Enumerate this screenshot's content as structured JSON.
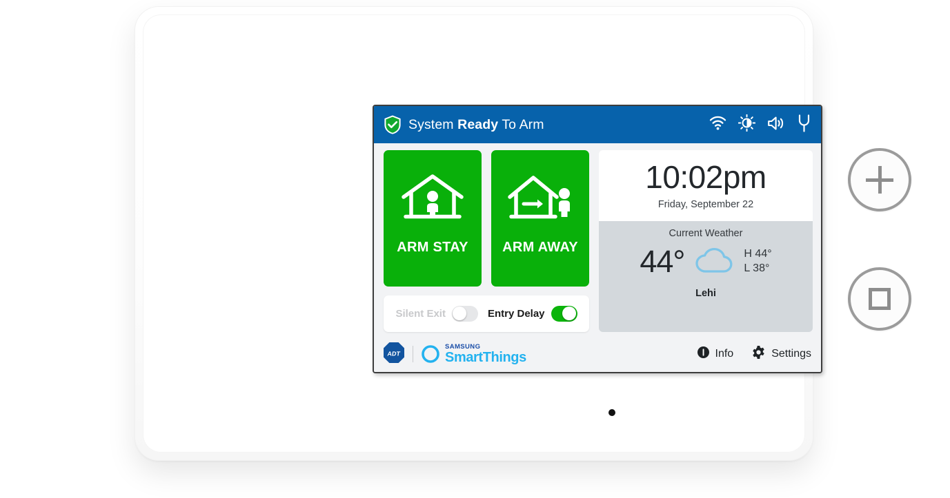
{
  "device": {
    "name": "adt-smartthings-security-panel",
    "hardware_buttons": [
      {
        "name": "panic-button",
        "icon": "plus-icon"
      },
      {
        "name": "home-button",
        "icon": "square-icon"
      }
    ],
    "microphone": "mic-dot"
  },
  "statusbar": {
    "shield_icon": "shield-check-icon",
    "status_prefix": "System ",
    "status_bold": "Ready",
    "status_suffix": " To Arm",
    "icons": [
      {
        "name": "wifi-icon",
        "label": "wifi"
      },
      {
        "name": "brightness-icon",
        "label": "brightness"
      },
      {
        "name": "volume-icon",
        "label": "volume"
      },
      {
        "name": "power-plug-icon",
        "label": "power"
      }
    ]
  },
  "arm_buttons": [
    {
      "name": "arm-stay-button",
      "label": "ARM STAY",
      "icon": "house-person-inside-icon",
      "color": "#09b00a"
    },
    {
      "name": "arm-away-button",
      "label": "ARM AWAY",
      "icon": "house-arrow-person-outside-icon",
      "color": "#09b00a"
    }
  ],
  "toggles": [
    {
      "name": "silent-exit-toggle",
      "label": "Silent Exit",
      "state": "off"
    },
    {
      "name": "entry-delay-toggle",
      "label": "Entry Delay",
      "state": "on"
    }
  ],
  "clock": {
    "time": "10:02pm",
    "date": "Friday, September 22"
  },
  "weather": {
    "title": "Current Weather",
    "temperature": "44°",
    "condition_icon": "cloud-icon",
    "high": "H 44°",
    "low": "L 38°",
    "location": "Lehi"
  },
  "brand": {
    "adt_logo_text": "ADT",
    "samsung_label": "SAMSUNG",
    "smartthings_label": "SmartThings"
  },
  "bottom_actions": [
    {
      "name": "info-button",
      "label": "Info",
      "icon": "info-icon"
    },
    {
      "name": "settings-button",
      "label": "Settings",
      "icon": "gear-icon"
    }
  ],
  "colors": {
    "header_blue": "#0762ab",
    "arm_green": "#09b00a",
    "weather_panel": "#d3d8dc",
    "screen_bg": "#f2f3f5",
    "smartthings_cyan": "#23b2ef",
    "samsung_blue": "#1b4ea8"
  }
}
